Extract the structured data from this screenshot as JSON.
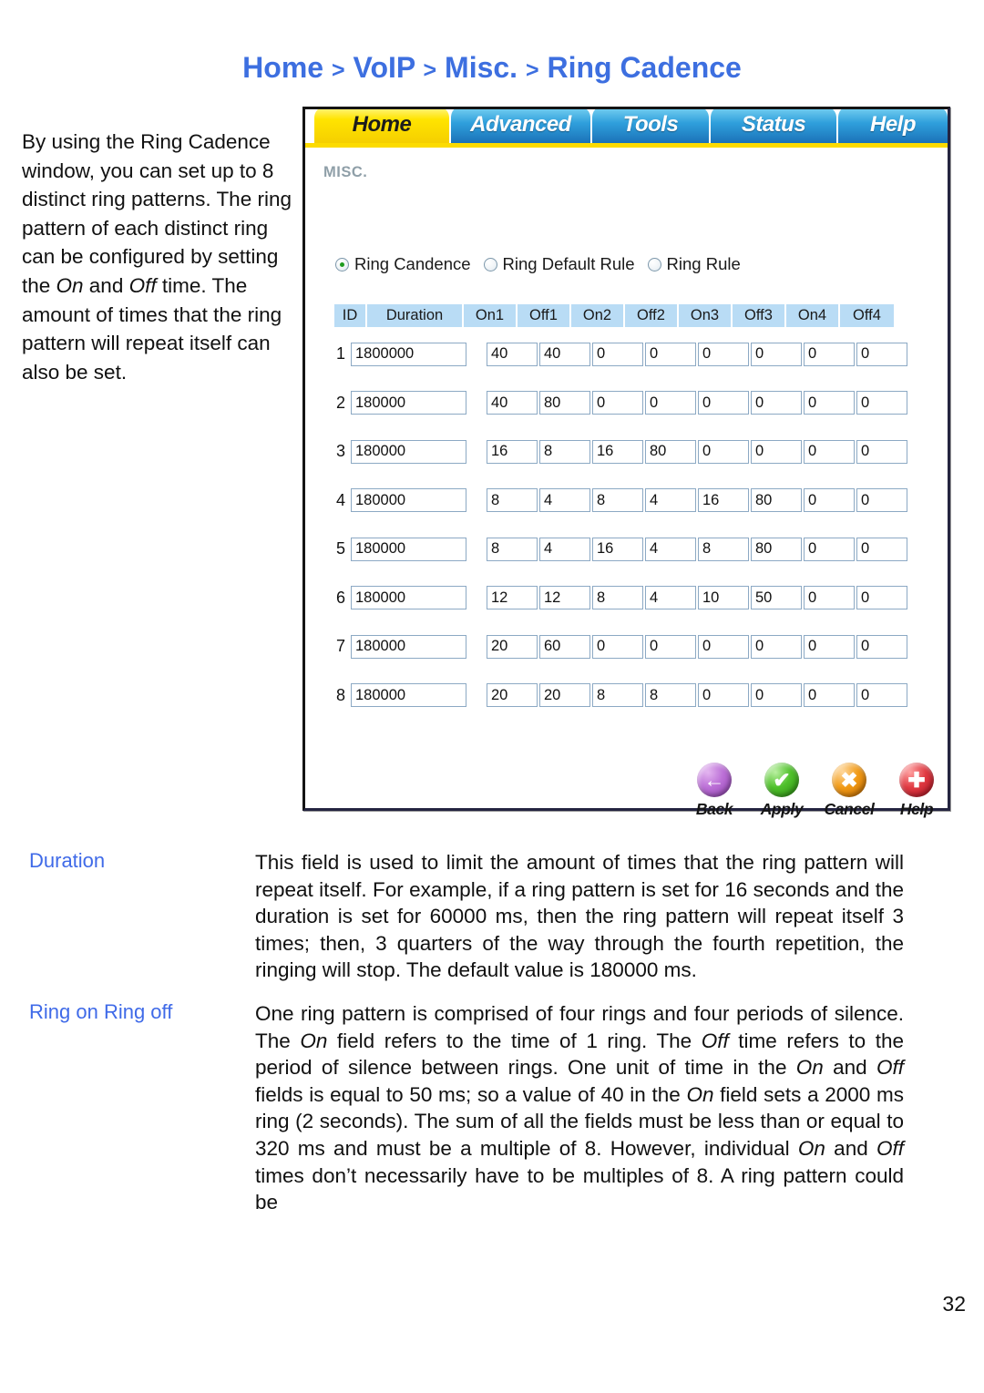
{
  "page": {
    "title_parts": [
      "Home",
      ">",
      "VoIP",
      ">",
      "Misc.",
      ">",
      "Ring Cadence"
    ],
    "title": "Home > VoIP > Misc. > Ring Cadence",
    "number": "32"
  },
  "intro": {
    "part1": "By using the Ring Cadence window, you can set up to 8 distinct ring patterns. The ring pattern of each distinct ring can be configured by setting the ",
    "on": "On",
    "and": " and ",
    "off": "Off",
    "part2": " time. The amount of times that the ring pattern will repeat itself can also be set."
  },
  "screenshot": {
    "tabs": [
      {
        "label": "Home",
        "active": true
      },
      {
        "label": "Advanced",
        "active": false
      },
      {
        "label": "Tools",
        "active": false
      },
      {
        "label": "Status",
        "active": false
      },
      {
        "label": "Help",
        "active": false
      }
    ],
    "section_label": "MISC.",
    "radios": [
      {
        "label": "Ring Candence",
        "selected": true
      },
      {
        "label": "Ring Default Rule",
        "selected": false
      },
      {
        "label": "Ring Rule",
        "selected": false
      }
    ],
    "table": {
      "headers": [
        "ID",
        "Duration",
        "On1",
        "Off1",
        "On2",
        "Off2",
        "On3",
        "Off3",
        "On4",
        "Off4"
      ],
      "rows": [
        {
          "id": "1",
          "duration": "1800000",
          "values": [
            "40",
            "40",
            "0",
            "0",
            "0",
            "0",
            "0",
            "0"
          ]
        },
        {
          "id": "2",
          "duration": "180000",
          "values": [
            "40",
            "80",
            "0",
            "0",
            "0",
            "0",
            "0",
            "0"
          ]
        },
        {
          "id": "3",
          "duration": "180000",
          "values": [
            "16",
            "8",
            "16",
            "80",
            "0",
            "0",
            "0",
            "0"
          ]
        },
        {
          "id": "4",
          "duration": "180000",
          "values": [
            "8",
            "4",
            "8",
            "4",
            "16",
            "80",
            "0",
            "0"
          ]
        },
        {
          "id": "5",
          "duration": "180000",
          "values": [
            "8",
            "4",
            "16",
            "4",
            "8",
            "80",
            "0",
            "0"
          ]
        },
        {
          "id": "6",
          "duration": "180000",
          "values": [
            "12",
            "12",
            "8",
            "4",
            "10",
            "50",
            "0",
            "0"
          ]
        },
        {
          "id": "7",
          "duration": "180000",
          "values": [
            "20",
            "60",
            "0",
            "0",
            "0",
            "0",
            "0",
            "0"
          ]
        },
        {
          "id": "8",
          "duration": "180000",
          "values": [
            "20",
            "20",
            "8",
            "8",
            "0",
            "0",
            "0",
            "0"
          ]
        }
      ]
    },
    "buttons": [
      {
        "label": "Back",
        "icon": "back-arrow-icon",
        "glyph": "←",
        "color": "#8e3fae"
      },
      {
        "label": "Apply",
        "icon": "check-icon",
        "glyph": "✔",
        "color": "#2b8d11"
      },
      {
        "label": "Cancel",
        "icon": "cross-icon",
        "glyph": "✖",
        "color": "#c46a00"
      },
      {
        "label": "Help",
        "icon": "plus-icon",
        "glyph": "✚",
        "color": "#ae1020"
      }
    ]
  },
  "definitions": [
    {
      "term": "Duration",
      "body_1": "This field is used to limit the amount of times that the ring pattern will repeat itself. For example, if a ring pattern is set for 16 seconds and the duration is set for 60000 ms, then the ring pattern will repeat itself 3 times; then, 3 quarters of the way through the fourth repetition, the ringing will stop. The default value is 180000 ms."
    },
    {
      "term": "Ring on Ring off",
      "seg_1": "One ring pattern is comprised of four rings and four periods of silence. The ",
      "em_1": "On",
      "seg_2": " field refers to the time of 1 ring.  The ",
      "em_2": "Off",
      "seg_3": " time refers to the period of silence between rings. One unit of time in the ",
      "em_3": "On",
      "seg_4": " and ",
      "em_4": "Off",
      "seg_5": " fields is equal to 50 ms; so a value of 40 in the ",
      "em_5": "On",
      "seg_6": " field sets a 2000 ms ring (2 seconds). The sum of all the fields must be less than or equal to 320 ms and must be a multiple of 8. However, individual ",
      "em_6": "On",
      "seg_7": " and ",
      "em_7": "Off",
      "seg_8": " times don’t necessarily have to be multiples of 8. A ring pattern could be"
    }
  ],
  "colors": {
    "title_blue": "#3d6fe0",
    "term_blue": "#3f6ae8",
    "tab_active_yellow": "#ffe400",
    "tab_inactive_blue": "#2f9fdc",
    "table_header_blue": "#b9dcf5"
  }
}
